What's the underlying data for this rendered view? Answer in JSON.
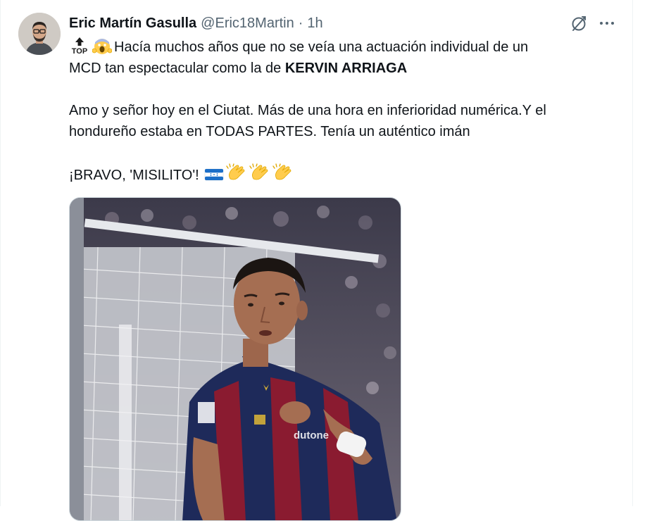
{
  "tweet": {
    "author_name": "Eric Martín Gasulla",
    "handle": "@Eric18Martin",
    "separator": "·",
    "time": "1h",
    "text": {
      "line1_rest": "Hacía muchos años que no se veía una actuación individual de un",
      "line2_prefix": "MCD tan espectacular como la de ",
      "line2_bold": "KERVIN ARRIAGA",
      "line3": "Amo y señor hoy en el Ciutat. Más de una hora en inferioridad numérica.Y el",
      "line4": "hondureño estaba en TODAS PARTES. Tenía un auténtico imán",
      "line5": "¡BRAVO, 'MISILITO'!"
    },
    "emoji_icons": [
      "top-arrow-icon",
      "screaming-face-icon",
      "honduras-flag-icon",
      "clapping-hands-icon",
      "clapping-hands-icon",
      "clapping-hands-icon"
    ],
    "top_badge_text": "TOP",
    "media": {
      "jersey_sponsor": "dutone"
    },
    "colors": {
      "text": "#0f1419",
      "secondary": "#536471",
      "border": "#cfd9de",
      "jersey_blue": "#1e2a5a",
      "jersey_red": "#8a1b30"
    }
  }
}
